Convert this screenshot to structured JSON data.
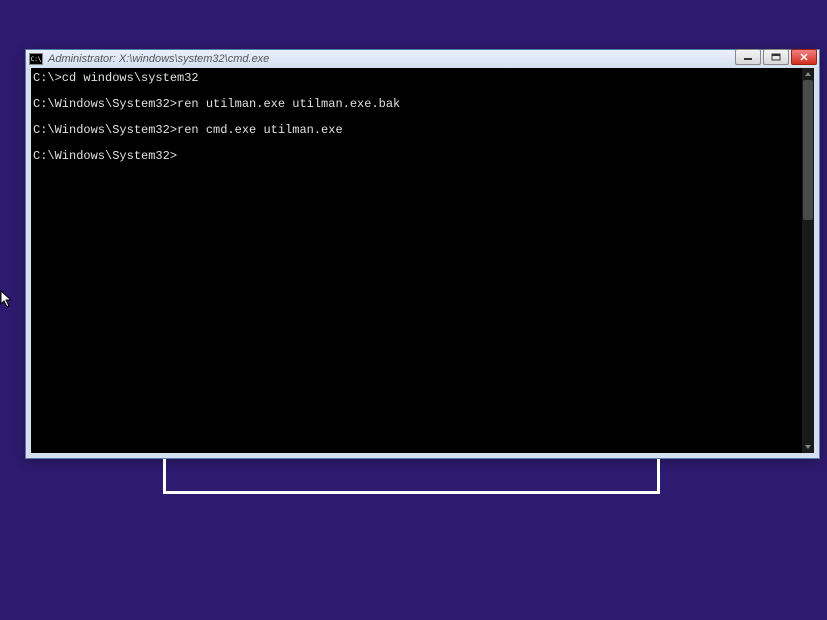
{
  "window": {
    "title": "Administrator: X:\\windows\\system32\\cmd.exe",
    "icon_label": "C:\\"
  },
  "terminal": {
    "lines": [
      {
        "prompt": "C:\\>",
        "command": "cd windows\\system32"
      },
      {
        "prompt": "C:\\Windows\\System32>",
        "command": "ren utilman.exe utilman.exe.bak"
      },
      {
        "prompt": "C:\\Windows\\System32>",
        "command": "ren cmd.exe utilman.exe"
      },
      {
        "prompt": "C:\\Windows\\System32>",
        "command": ""
      }
    ]
  },
  "colors": {
    "background": "#2e1a6e",
    "titlebar": "#d4e0f0",
    "terminal_bg": "#000000",
    "terminal_fg": "#e0e0e0",
    "close_btn": "#d03020"
  }
}
